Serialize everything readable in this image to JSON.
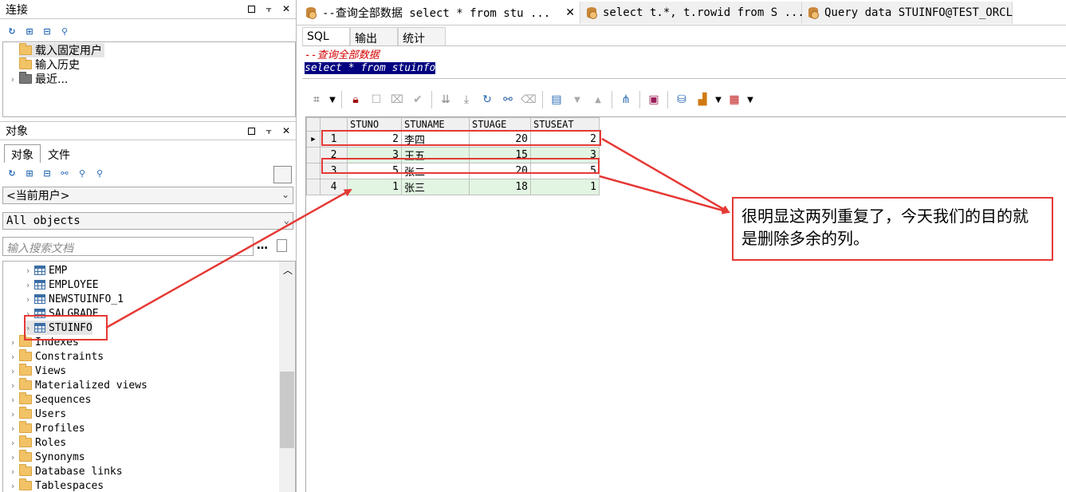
{
  "connection_panel": {
    "title": "连接",
    "items": [
      {
        "label": "载入固定用户"
      },
      {
        "label": "输入历史"
      },
      {
        "label": "最近..."
      }
    ]
  },
  "object_panel": {
    "title": "对象",
    "tabs": [
      "对象",
      "文件"
    ],
    "user_combo": "<当前用户>",
    "type_combo": "All objects",
    "search_placeholder": "输入搜索文档",
    "tables": [
      "EMP",
      "EMPLOYEE",
      "NEWSTUINFO_1",
      "SALGRADE",
      "STUINFO"
    ],
    "folders": [
      "Indexes",
      "Constraints",
      "Views",
      "Materialized views",
      "Sequences",
      "Users",
      "Profiles",
      "Roles",
      "Synonyms",
      "Database links",
      "Tablespaces"
    ]
  },
  "doc_tabs": [
    {
      "label": "--查询全部数据 select * from stu ..."
    },
    {
      "label": "select t.*, t.rowid from S ..."
    },
    {
      "label": "Query data STUINFO@TEST_ORCL"
    }
  ],
  "sub_tabs": [
    "SQL",
    "输出",
    "统计"
  ],
  "editor": {
    "comment": "--查询全部数据",
    "query": "select * from stuinfo"
  },
  "grid": {
    "columns": [
      "STUNO",
      "STUNAME",
      "STUAGE",
      "STUSEAT"
    ],
    "rows": [
      {
        "n": "1",
        "STUNO": "2",
        "STUNAME": "李四",
        "STUAGE": "20",
        "STUSEAT": "2"
      },
      {
        "n": "2",
        "STUNO": "3",
        "STUNAME": "王五",
        "STUAGE": "15",
        "STUSEAT": "3"
      },
      {
        "n": "3",
        "STUNO": "5",
        "STUNAME": "张二",
        "STUAGE": "20",
        "STUSEAT": "5"
      },
      {
        "n": "4",
        "STUNO": "1",
        "STUNAME": "张三",
        "STUAGE": "18",
        "STUSEAT": "1"
      }
    ]
  },
  "annotation": {
    "text": "很明显这两列重复了，今天我们的目的就是删除多余的列。",
    "color": "#e53935"
  }
}
